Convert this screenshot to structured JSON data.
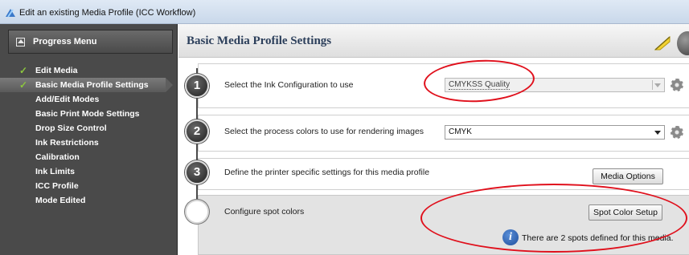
{
  "window": {
    "title": "Edit an existing Media Profile (ICC Workflow)"
  },
  "sidebar": {
    "header": "Progress Menu",
    "items": [
      {
        "label": "Edit Media",
        "checked": true,
        "active": false
      },
      {
        "label": "Basic Media Profile Settings",
        "checked": true,
        "active": true
      },
      {
        "label": "Add/Edit Modes",
        "checked": false,
        "active": false
      },
      {
        "label": "Basic Print Mode Settings",
        "checked": false,
        "active": false
      },
      {
        "label": "Drop Size Control",
        "checked": false,
        "active": false
      },
      {
        "label": "Ink Restrictions",
        "checked": false,
        "active": false
      },
      {
        "label": "Calibration",
        "checked": false,
        "active": false
      },
      {
        "label": "Ink Limits",
        "checked": false,
        "active": false
      },
      {
        "label": "ICC Profile",
        "checked": false,
        "active": false
      },
      {
        "label": "Mode Edited",
        "checked": false,
        "active": false
      }
    ],
    "check_glyph": "✓"
  },
  "main": {
    "heading": "Basic Media Profile Settings",
    "steps": [
      {
        "number": "1",
        "text": "Select the Ink Configuration to use",
        "select_value": "CMYKSS Quality"
      },
      {
        "number": "2",
        "text": "Select the process colors to use for rendering images",
        "select_value": "CMYK"
      },
      {
        "number": "3",
        "text": "Define the printer specific settings for this media profile",
        "button": "Media Options"
      },
      {
        "number": "",
        "text": "Configure spot colors",
        "button": "Spot Color Setup",
        "info": "There are 2 spots defined for this media."
      }
    ]
  },
  "icons": {
    "info": "i",
    "help": "help-icon",
    "flag": "flag-icon",
    "gear": "gear-icon"
  },
  "colors": {
    "annotation": "#e0101c",
    "check": "#8cc63e",
    "heading": "#2b3e5a"
  }
}
